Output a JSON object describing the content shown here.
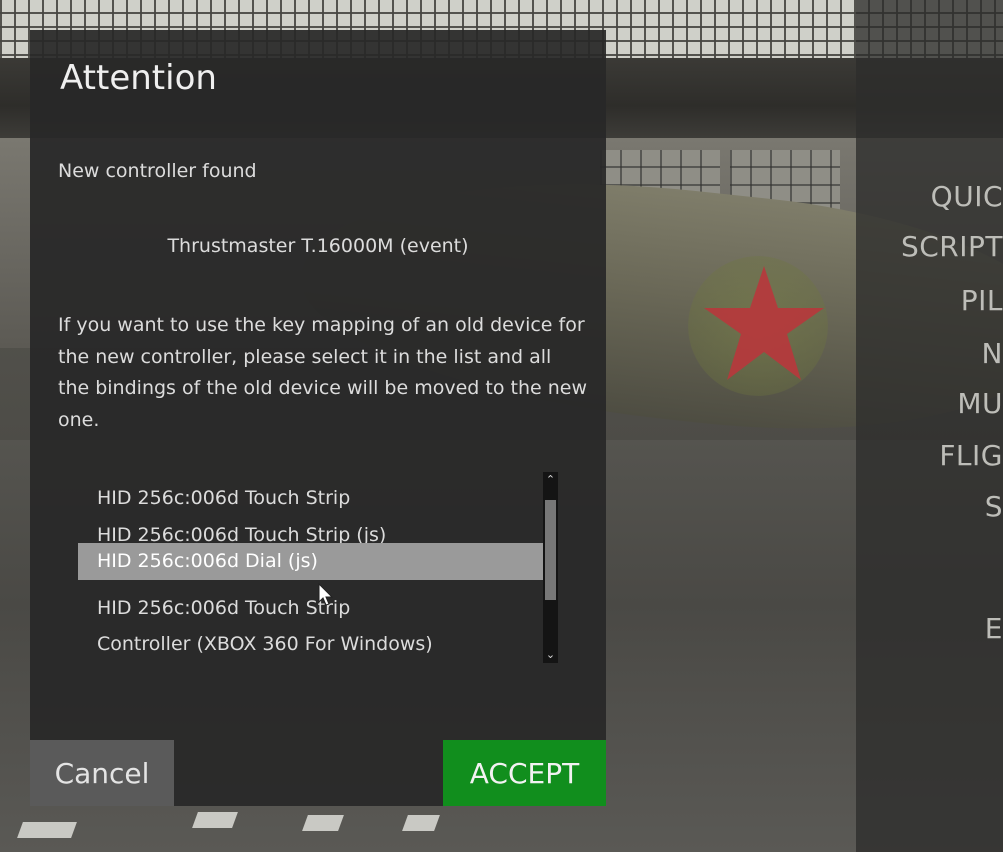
{
  "background_menu": {
    "items": [
      "QUIC",
      "SCRIPT",
      "PIL",
      "N",
      "MU",
      "FLIG",
      "S",
      "E"
    ]
  },
  "dialog": {
    "title": "Attention",
    "subtitle": "New controller found",
    "device_name": "Thrustmaster T.16000M (event)",
    "instructions": "If you want to use the key mapping of an old device for the new controller, please select it in the list and all the bindings of the old device will be moved to the new one.",
    "devices": [
      "HID 256c:006d Touch Strip",
      "HID 256c:006d Touch Strip (js)",
      "HID 256c:006d Dial (js)",
      "HID 256c:006d Touch Strip",
      "Controller (XBOX 360 For Windows)"
    ],
    "selected_device": "HID 256c:006d Dial (js)",
    "cancel_label": "Cancel",
    "accept_label": "ACCEPT"
  },
  "colors": {
    "accept": "#118e1d",
    "cancel": "#5a5a5a",
    "selection": "#9a9a9a",
    "roundel_star": "#b8373c"
  },
  "icons": {
    "scroll_up": "chevron-up-icon",
    "scroll_down": "chevron-down-icon",
    "pointer": "mouse-cursor-icon"
  }
}
